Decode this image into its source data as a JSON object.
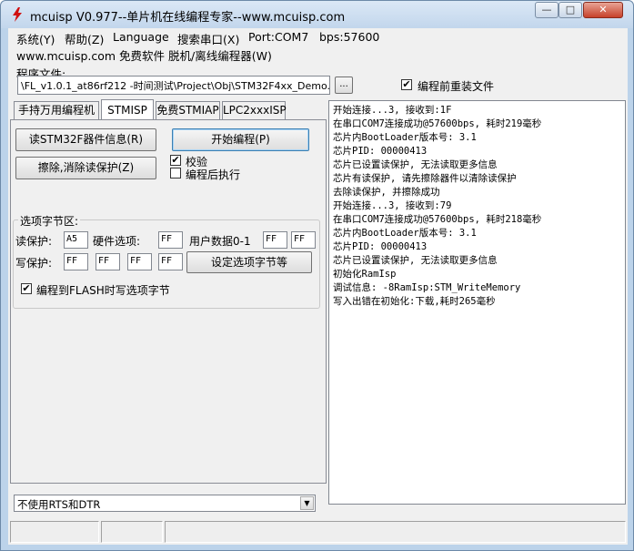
{
  "window": {
    "title": "mcuisp V0.977--单片机在线编程专家--www.mcuisp.com",
    "minimize": "—",
    "maximize": "□",
    "close": "✕"
  },
  "menu": {
    "items": [
      "系统(Y)",
      "帮助(Z)",
      "Language",
      "搜索串口(X)",
      "Port:COM7",
      "bps:57600"
    ],
    "second_row": "www.mcuisp.com 免费软件 脱机/离线编程器(W)"
  },
  "program_file": {
    "label": "程序文件:",
    "path": "\\FL_v1.0.1_at86rf212 -时间测试\\Project\\Obj\\STM32F4xx_Demo.hex",
    "browse_label": "...",
    "reload_label": "编程前重装文件",
    "reload_checked": true
  },
  "tabs": [
    "手持万用编程机",
    "STMISP",
    "免费STMIAP",
    "LPC2xxxISP"
  ],
  "active_tab": "STMISP",
  "actions": {
    "read_info": "读STM32F器件信息(R)",
    "start_program": "开始编程(P)",
    "erase_protect": "擦除,消除读保护(Z)",
    "verify_label": "校验",
    "verify_checked": true,
    "run_after_label": "编程后执行",
    "run_after_checked": false
  },
  "option_bytes": {
    "title": "选项字节区:",
    "read_protect_label": "读保护:",
    "read_protect_value": "A5",
    "hardware_label": "硬件选项:",
    "hardware_value": "FF",
    "user_data_label": "用户数据0-1",
    "user_data": [
      "FF",
      "FF"
    ],
    "write_protect_label": "写保护:",
    "write_protect": [
      "FF",
      "FF",
      "FF",
      "FF"
    ],
    "set_button": "设定选项字节等",
    "write_flash_label": "编程到FLASH时写选项字节",
    "write_flash_checked": true
  },
  "log_lines": [
    "开始连接...3, 接收到:1F",
    "在串口COM7连接成功@57600bps, 耗时219毫秒",
    "芯片内BootLoader版本号: 3.1",
    "芯片PID: 00000413",
    "芯片已设置读保护, 无法读取更多信息",
    "芯片有读保护, 请先擦除器件以清除读保护",
    "去除读保护, 并擦除成功",
    "开始连接...3, 接收到:79",
    "在串口COM7连接成功@57600bps, 耗时218毫秒",
    "芯片内BootLoader版本号: 3.1",
    "芯片PID: 00000413",
    "芯片已设置读保护, 无法读取更多信息",
    "初始化RamIsp",
    "调试信息: -8RamIsp:STM_WriteMemory",
    "写入出错在初始化:下载,耗时265毫秒"
  ],
  "rts_dtr_select": "不使用RTS和DTR",
  "colors": {
    "title_bar": "#c2d6ec",
    "close_button": "#c7412a",
    "button_focus": "#3c7fb1"
  }
}
